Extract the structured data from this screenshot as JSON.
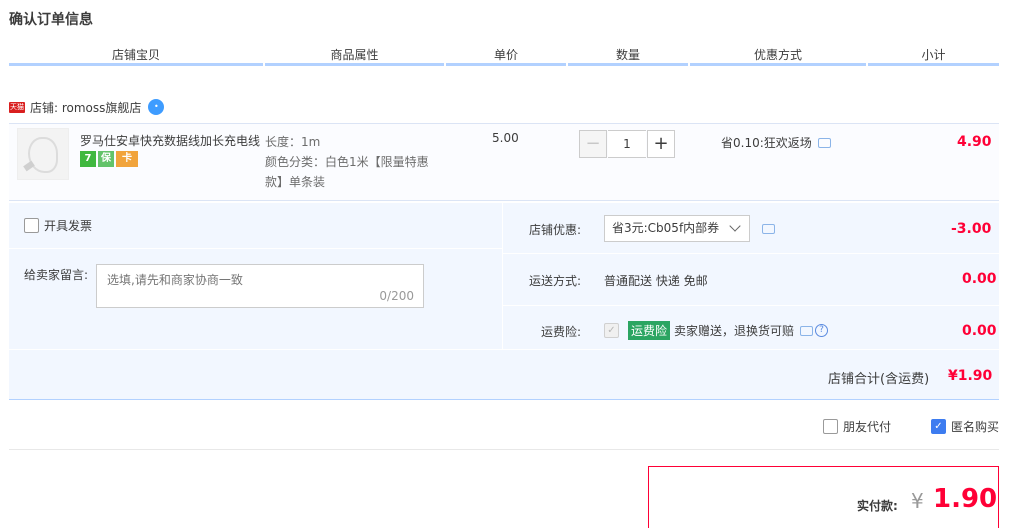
{
  "page_title": "确认订单信息",
  "columns": [
    "店铺宝贝",
    "商品属性",
    "单价",
    "数量",
    "优惠方式",
    "小计"
  ],
  "shop": {
    "badge": "天猫",
    "label": "店铺: romoss旗舰店"
  },
  "item": {
    "name": "罗马仕安卓快充数据线加长充电线",
    "service_icons": [
      "7",
      "保",
      "卡"
    ],
    "attr_length": "长度：1m",
    "attr_color": "颜色分类：白色1米【限量特惠款】单条装",
    "unit_price": "5.00",
    "quantity": "1",
    "promo": "省0.10:狂欢返场",
    "subtotal": "4.90"
  },
  "invoice_label": "开具发票",
  "message": {
    "label": "给卖家留言:",
    "placeholder": "选填,请先和商家协商一致",
    "counter": "0/200"
  },
  "coupon": {
    "label": "店铺优惠:",
    "selected": "省3元:Cb05f内部券",
    "amount": "-3.00"
  },
  "shipping": {
    "label": "运送方式:",
    "value": "普通配送 快递 免邮",
    "amount": "0.00"
  },
  "insurance": {
    "label": "运费险:",
    "badge": "运费险",
    "text": "卖家赠送，退换货可赔",
    "amount": "0.00"
  },
  "shop_total": {
    "label": "店铺合计(含运费)",
    "amount": "¥1.90"
  },
  "options": {
    "friend_pay": "朋友代付",
    "anonymous": "匿名购买"
  },
  "payment": {
    "label": "实付款:",
    "currency": "¥",
    "amount": "1.90"
  },
  "colors": {
    "accent_red": "#ff0036",
    "header_line": "#b2d1ff",
    "panel_bg": "#f2f7ff",
    "checkbox_blue": "#3d7cf0"
  }
}
